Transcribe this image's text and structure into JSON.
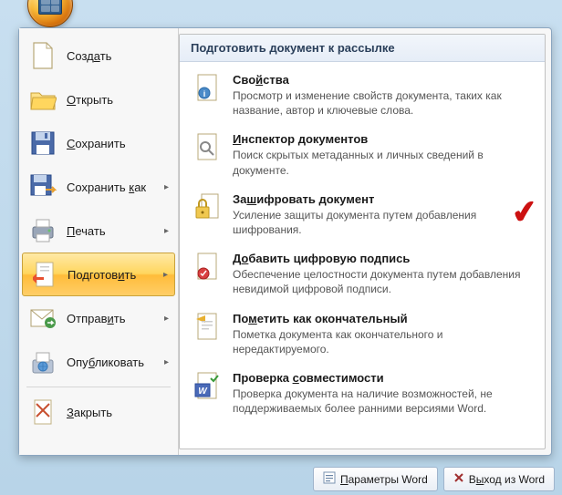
{
  "left_menu": {
    "items": [
      {
        "label": "Создать",
        "icon": "new-doc",
        "arrow": false
      },
      {
        "label": "Открыть",
        "icon": "open-folder",
        "arrow": false
      },
      {
        "label": "Сохранить",
        "icon": "save-disk",
        "arrow": false
      },
      {
        "label": "Сохранить как",
        "icon": "save-as",
        "arrow": true
      },
      {
        "label": "Печать",
        "icon": "print",
        "arrow": true
      },
      {
        "label": "Подготовить",
        "icon": "prepare",
        "arrow": true,
        "selected": true
      },
      {
        "label": "Отправить",
        "icon": "send-mail",
        "arrow": true
      },
      {
        "label": "Опубликовать",
        "icon": "publish",
        "arrow": true
      },
      {
        "label": "Закрыть",
        "icon": "close-doc",
        "arrow": false
      }
    ]
  },
  "right_panel": {
    "header": "Подготовить документ к рассылке",
    "items": [
      {
        "title": "Свойства",
        "desc": "Просмотр и изменение свойств документа, таких как название, автор и ключевые слова.",
        "icon": "properties"
      },
      {
        "title": "Инспектор документов",
        "desc": "Поиск скрытых метаданных и личных сведений в документе.",
        "icon": "inspect"
      },
      {
        "title": "Зашифровать документ",
        "desc": "Усиление защиты документа путем добавления шифрования.",
        "icon": "encrypt",
        "checkmark": true
      },
      {
        "title": "Добавить цифровую подпись",
        "desc": "Обеспечение целостности документа путем добавления невидимой цифровой подписи.",
        "icon": "signature"
      },
      {
        "title": "Пометить как окончательный",
        "desc": "Пометка документа как окончательного и нередактируемого.",
        "icon": "final"
      },
      {
        "title": "Проверка совместимости",
        "desc": "Проверка документа на наличие возможностей, не поддерживаемых более ранними версиями Word.",
        "icon": "compat"
      }
    ]
  },
  "bottom": {
    "options_label": "Параметры Word",
    "exit_label": "Выход из Word"
  }
}
